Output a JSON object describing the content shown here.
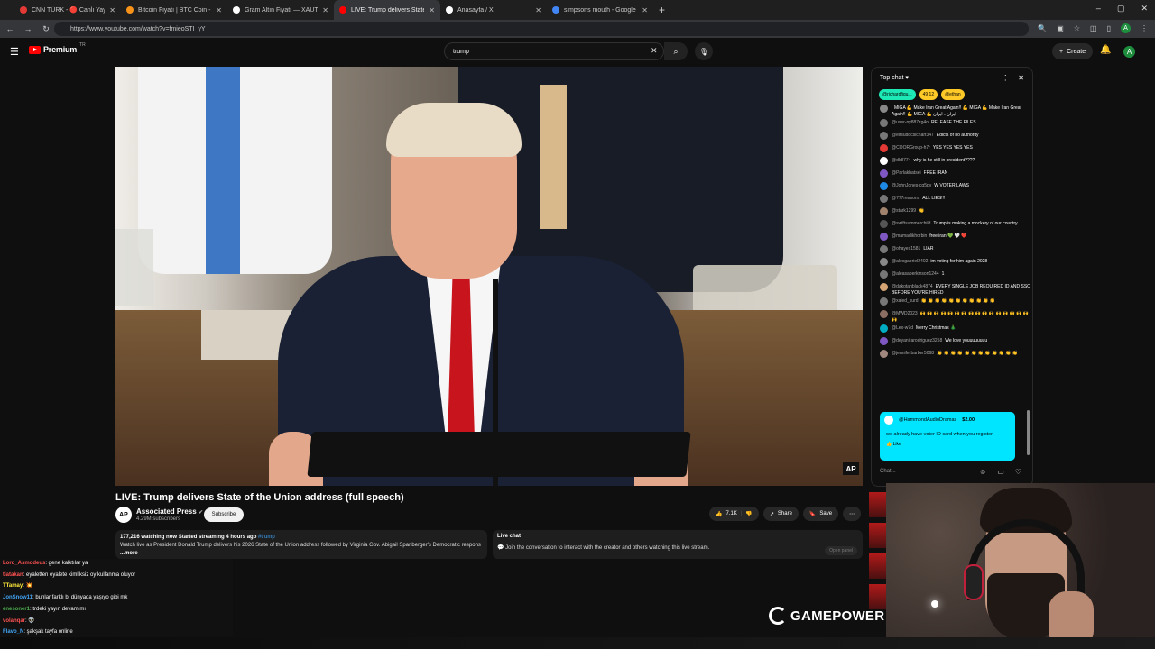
{
  "browser": {
    "tabs": [
      {
        "label": "CNN TÜRK - 🔴 Canlı Yayın ᴴᴰ",
        "color": "#e53935"
      },
      {
        "label": "Bitcoin Fiyatı | BTC Coin - Inves...",
        "color": "#f7931a"
      },
      {
        "label": "Gram Altın Fiyatı — XAUTRYG |...",
        "color": "#ffffff"
      },
      {
        "label": "LIVE: Trump delivers State o...",
        "color": "#ff0000"
      },
      {
        "label": "Anasayfa / X",
        "color": "#ffffff"
      },
      {
        "label": "simpsons mouth - Google Sea...",
        "color": "#4285f4"
      }
    ],
    "url": "https://www.youtube.com/watch?v=fmieoSTI_yY"
  },
  "youtube": {
    "logo_text": "Premium",
    "logo_sup": "TR",
    "search_value": "trump",
    "create_label": "Create",
    "avatar_letter": "A"
  },
  "video": {
    "title": "LIVE: Trump delivers State of the Union address (full speech)",
    "ap_badge": "AP",
    "channel_logo": "AP",
    "channel_name": "Associated Press",
    "subscribers": "4.29M subscribers",
    "subscribe_label": "Subscribe",
    "likes": "7.1K",
    "share_label": "Share",
    "save_label": "Save",
    "desc_stats": "177,216 watching now  Started streaming 4 hours ago",
    "desc_hashtag": "#trump",
    "desc_text": "Watch live as President Donald Trump delivers his 2026 State of the Union address followed by Virginia Gov. Abigail Spanberger's Democratic respons",
    "desc_more": "...more",
    "livechat_heading": "Live chat",
    "livechat_text": "Join the conversation to interact with the creator and others watching this live stream.",
    "open_panel": "Open panel"
  },
  "chat": {
    "mode": "Top chat",
    "tickers": [
      {
        "label": "@richardfigu...",
        "color": "#1de9b6"
      },
      {
        "label": "49  12",
        "color": "#ffca28"
      },
      {
        "label": "@ethan",
        "color": "#ffca28"
      }
    ],
    "messages": [
      {
        "author": "",
        "text": "MIGA 💪 Make Iran Great Again!! 💪 MIGA 💪 Make Iran Great Again!! 💪 MIGA 💪 ایران ، ایران",
        "color": "#888888"
      },
      {
        "author": "@user-ny887zg4o",
        "text": "RELEASE THE FILES",
        "color": "#777777"
      },
      {
        "author": "@eitsudocsicnarf347",
        "text": "Edicts of no authority",
        "color": "#777777"
      },
      {
        "author": "@COORGroup-h7r",
        "text": "YES YES YES YES",
        "color": "#e53935"
      },
      {
        "author": "@dk8774",
        "text": "why is he still in president????",
        "color": "#ffffff"
      },
      {
        "author": "@Parlakhatsei",
        "text": "FREE IRAN",
        "color": "#7e57c2"
      },
      {
        "author": "@JohnJones-cq5pv",
        "text": "W VOTER LAWS",
        "color": "#1e88e5"
      },
      {
        "author": "@777reasons",
        "text": "ALL LIES!!!",
        "color": "#777777"
      },
      {
        "author": "@stark1299",
        "text": "👏",
        "color": "#a0826d"
      },
      {
        "author": "@swiftsummerchild",
        "text": "Trump is making a mockery of our country",
        "color": "#555555"
      },
      {
        "author": "@mamadikhorbin",
        "text": "free iran 💚 🤍 ❤️",
        "color": "#7e57c2"
      },
      {
        "author": "@ohayes1581",
        "text": "LIAR",
        "color": "#777777"
      },
      {
        "author": "@alexgabriel2402",
        "text": "im voting for him again 2028",
        "color": "#888888"
      },
      {
        "author": "@aleasaperkinson1244",
        "text": "1",
        "color": "#777777"
      },
      {
        "author": "@dakotahblack4874",
        "text": "EVERY SINGLE JOB REQUIRED ID AND SSC BEFORE YOU'RE HIRED",
        "color": "#d4a373"
      },
      {
        "author": "@xaled_kurd",
        "text": "👏 👏 👏 👏 👏 👏 👏 👏 👏 👏 👏",
        "color": "#777777"
      },
      {
        "author": "@MWD2023",
        "text": "🙌 🙌 🙌 🙌 🙌 🙌 🙌 🙌 🙌 🙌 🙌 🙌 🙌 🙌 🙌 🙌 🙌",
        "color": "#8d6e63"
      },
      {
        "author": "@Lex-w7d",
        "text": "Merry Christmas 🎄",
        "color": "#00acc1"
      },
      {
        "author": "@deyanirarodriguez3258",
        "text": "We love youuuuuuuu",
        "color": "#7e57c2"
      },
      {
        "author": "@jenniferbarber5068",
        "text": "👏 👏 👏 👏 👏 👏 👏 👏 👏 👏 👏 👏",
        "color": "#a1887f"
      }
    ],
    "superchat": {
      "author": "@HammondAudioDramas",
      "amount": "$2.00",
      "text": "we already have voter ID card when you register",
      "like": "Like"
    },
    "input_placeholder": "Chat..."
  },
  "overlay_chat": [
    {
      "name": "Lord_Asmodeus",
      "text": ": gene kalktılar ya",
      "color": "#ff5252"
    },
    {
      "name": "tiatakan",
      "text": ": eyaletten eyalete kimliksiz oy kullanma oluyor",
      "color": "#ff5252"
    },
    {
      "name": "TTamay",
      "text": ": 💥",
      "color": "#ffeb3b"
    },
    {
      "name": "JonSnow11",
      "text": ": bunlar farklı bi dünyada yaşıyo gibi mk",
      "color": "#42a5f5"
    },
    {
      "name": "enesoner1",
      "text": ": trdeki yayın devam mı",
      "color": "#4caf50"
    },
    {
      "name": "volanqar",
      "text": ": 👽",
      "color": "#ff5252"
    },
    {
      "name": "Flavo_N",
      "text": ": şakşak tayfa online",
      "color": "#42a5f5"
    }
  ],
  "brand": {
    "watermark": "GAMEPOWER"
  }
}
